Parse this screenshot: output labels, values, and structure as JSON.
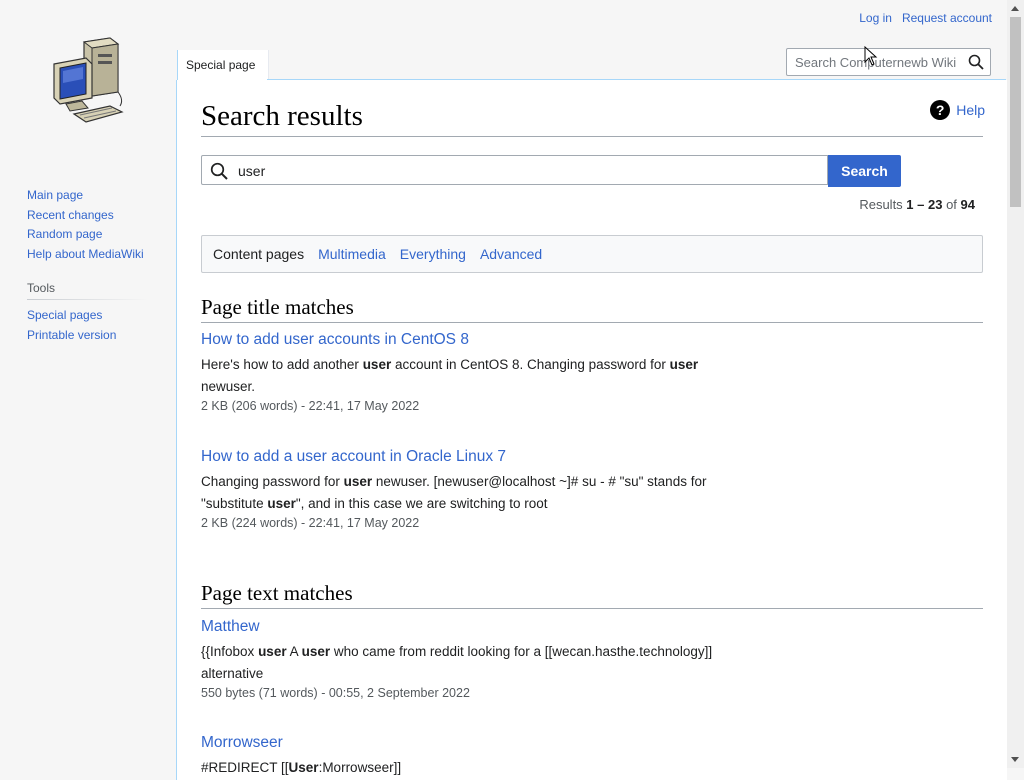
{
  "personal": {
    "login": "Log in",
    "request_account": "Request account"
  },
  "tab": {
    "label": "Special page"
  },
  "header_search": {
    "placeholder": "Search Computernewb Wiki"
  },
  "sidebar": {
    "nav": [
      "Main page",
      "Recent changes",
      "Random page",
      "Help about MediaWiki"
    ],
    "tools_heading": "Tools",
    "tools": [
      "Special pages",
      "Printable version"
    ]
  },
  "page": {
    "title": "Search results",
    "help": "Help",
    "query": "user",
    "search_button": "Search",
    "results_prefix": "Results ",
    "results_range": "1 – 23",
    "results_of": " of ",
    "results_total": "94"
  },
  "filters": {
    "current": "Content pages",
    "links": [
      "Multimedia",
      "Everything",
      "Advanced"
    ]
  },
  "sections": {
    "title_matches": "Page title matches",
    "text_matches": "Page text matches"
  },
  "title_results": [
    {
      "title": "How to add user accounts in CentOS 8",
      "snippet_html": "Here's how to add another <b>user</b> account in CentOS 8. Changing password for <b>user</b> newuser.",
      "meta": "2 KB (206 words) - 22:41, 17 May 2022"
    },
    {
      "title": "How to add a user account in Oracle Linux 7",
      "snippet_html": "Changing password for <b>user</b> newuser. [newuser@localhost ~]# su - # \"su\" stands for \"substitute <b>user</b>\", and in this case we are switching to root",
      "meta": "2 KB (224 words) - 22:41, 17 May 2022"
    }
  ],
  "text_results": [
    {
      "title": "Matthew",
      "snippet_html": "{{Infobox <b>user</b> A <b>user</b> who came from reddit looking for a [[wecan.hasthe.technology]] alternative",
      "meta": "550 bytes (71 words) - 00:55, 2 September 2022"
    },
    {
      "title": "Morrowseer",
      "snippet_html": "#REDIRECT [[<b>User</b>:Morrowseer]]",
      "meta": ""
    }
  ]
}
